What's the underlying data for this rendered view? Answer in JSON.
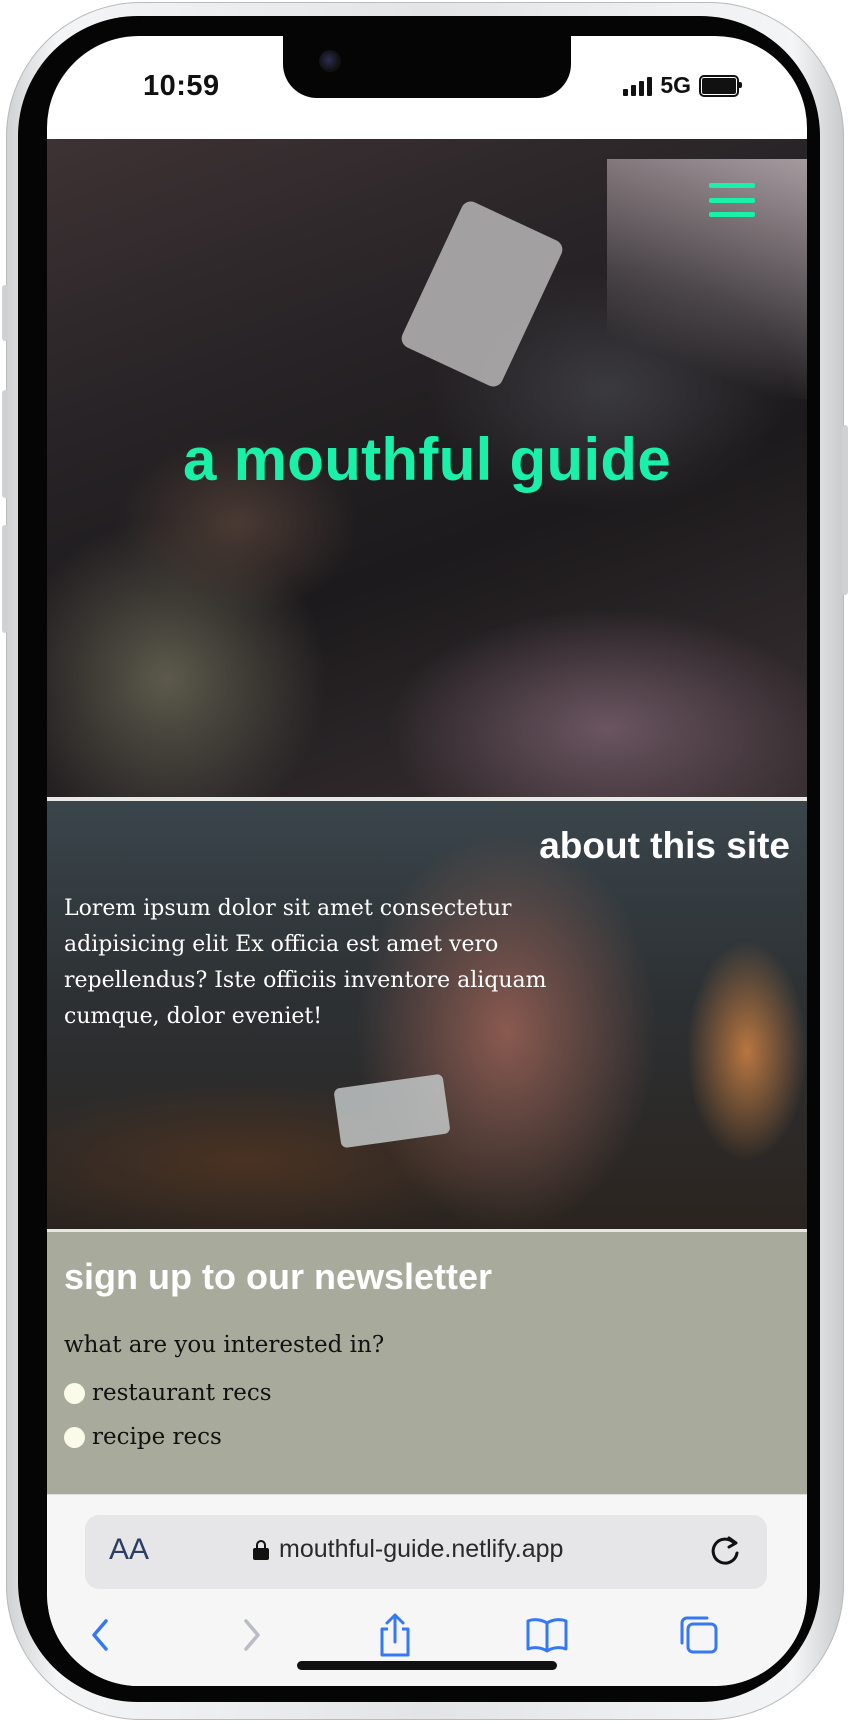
{
  "status_bar": {
    "time": "10:59",
    "network": "5G"
  },
  "site": {
    "title": "a mouthful guide",
    "about": {
      "heading": "about this site",
      "body": "Lorem ipsum dolor sit amet consectetur adipisicing elit Ex officia est amet vero repellendus? Iste officiis inventore aliquam cumque, dolor eveniet!"
    },
    "newsletter": {
      "heading": "sign up to our newsletter",
      "question": "what are you interested in?",
      "options": [
        "restaurant recs",
        "recipe recs"
      ]
    }
  },
  "browser": {
    "text_size_label": "AA",
    "url": "mouthful-guide.netlify.app",
    "toolbar_icons": [
      "back-icon",
      "forward-icon",
      "share-icon",
      "bookmarks-icon",
      "tabs-icon"
    ]
  },
  "colors": {
    "accent": "#19f0a8",
    "newsletter_bg": "#a8ab9b",
    "safari_icon": "#3478f6"
  }
}
